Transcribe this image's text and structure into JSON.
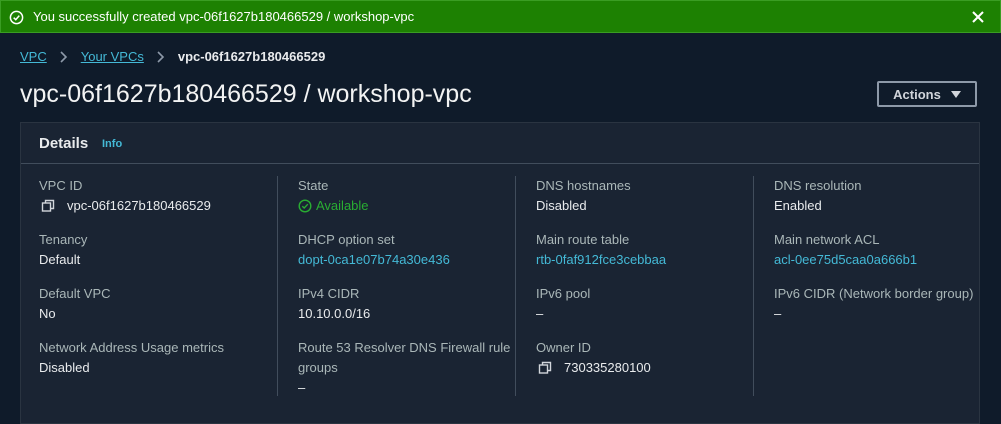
{
  "flash": {
    "message": "You successfully created vpc-06f1627b180466529 / workshop-vpc"
  },
  "breadcrumb": {
    "items": [
      "VPC",
      "Your VPCs"
    ],
    "current": "vpc-06f1627b180466529"
  },
  "page": {
    "title": "vpc-06f1627b180466529 / workshop-vpc",
    "actions_label": "Actions"
  },
  "details": {
    "title": "Details",
    "info": "Info",
    "fields": {
      "vpc_id": {
        "label": "VPC ID",
        "value": "vpc-06f1627b180466529"
      },
      "state": {
        "label": "State",
        "value": "Available"
      },
      "dns_hostnames": {
        "label": "DNS hostnames",
        "value": "Disabled"
      },
      "dns_resolution": {
        "label": "DNS resolution",
        "value": "Enabled"
      },
      "tenancy": {
        "label": "Tenancy",
        "value": "Default"
      },
      "dhcp_option_set": {
        "label": "DHCP option set",
        "value": "dopt-0ca1e07b74a30e436"
      },
      "main_route_table": {
        "label": "Main route table",
        "value": "rtb-0faf912fce3cebbaa"
      },
      "main_network_acl": {
        "label": "Main network ACL",
        "value": "acl-0ee75d5caa0a666b1"
      },
      "default_vpc": {
        "label": "Default VPC",
        "value": "No"
      },
      "ipv4_cidr": {
        "label": "IPv4 CIDR",
        "value": "10.10.0.0/16"
      },
      "ipv6_pool": {
        "label": "IPv6 pool",
        "value": "–"
      },
      "ipv6_cidr": {
        "label": "IPv6 CIDR (Network border group)",
        "value": "–"
      },
      "network_address_usage": {
        "label": "Network Address Usage metrics",
        "value": "Disabled"
      },
      "route53_resolver": {
        "label": "Route 53 Resolver DNS Firewall rule groups",
        "value": "–"
      },
      "owner_id": {
        "label": "Owner ID",
        "value": "730335280100"
      }
    }
  },
  "colors": {
    "success_banner": "#1d8102",
    "link": "#44b9d6",
    "status_ok": "#29ad32",
    "background": "#0f1b2a",
    "panel": "#1a2433"
  },
  "icons": [
    "success-check-icon",
    "close-icon",
    "chevron-right-icon",
    "caret-down-icon",
    "copy-icon",
    "status-ok-icon"
  ]
}
